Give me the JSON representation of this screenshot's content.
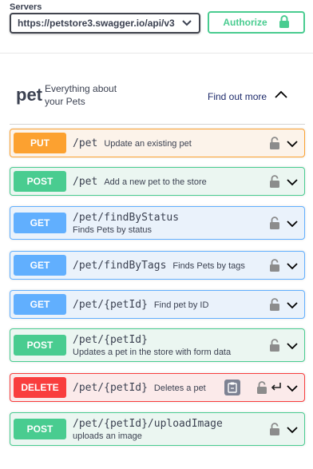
{
  "servers": {
    "label": "Servers",
    "selected": "https://petstore3.swagger.io/api/v3"
  },
  "authorize": {
    "label": "Authorize"
  },
  "tag": {
    "name": "pet",
    "description": "Everything about your Pets",
    "link": "Find out more"
  },
  "operations": [
    {
      "method": "PUT",
      "path": "/pet",
      "summary": "Update an existing pet"
    },
    {
      "method": "POST",
      "path": "/pet",
      "summary": "Add a new pet to the store"
    },
    {
      "method": "GET",
      "path": "/pet/findByStatus",
      "summary": "Finds Pets by status"
    },
    {
      "method": "GET",
      "path": "/pet/findByTags",
      "summary": "Finds Pets by tags"
    },
    {
      "method": "GET",
      "path": "/pet/{petId}",
      "summary": "Find pet by ID"
    },
    {
      "method": "POST",
      "path": "/pet/{petId}",
      "summary": "Updates a pet in the store with form data"
    },
    {
      "method": "DELETE",
      "path": "/pet/{petId}",
      "summary": "Deletes a pet"
    },
    {
      "method": "POST",
      "path": "/pet/{petId}/uploadImage",
      "summary": "uploads an image"
    }
  ],
  "colors": {
    "put": "#fca130",
    "post": "#49cc90",
    "get": "#61affe",
    "delete": "#f93e3e"
  },
  "icons": {
    "lock": "lock-icon",
    "chevron": "chevron-down-icon",
    "copy": "copy-icon",
    "enter": "enter-icon"
  }
}
